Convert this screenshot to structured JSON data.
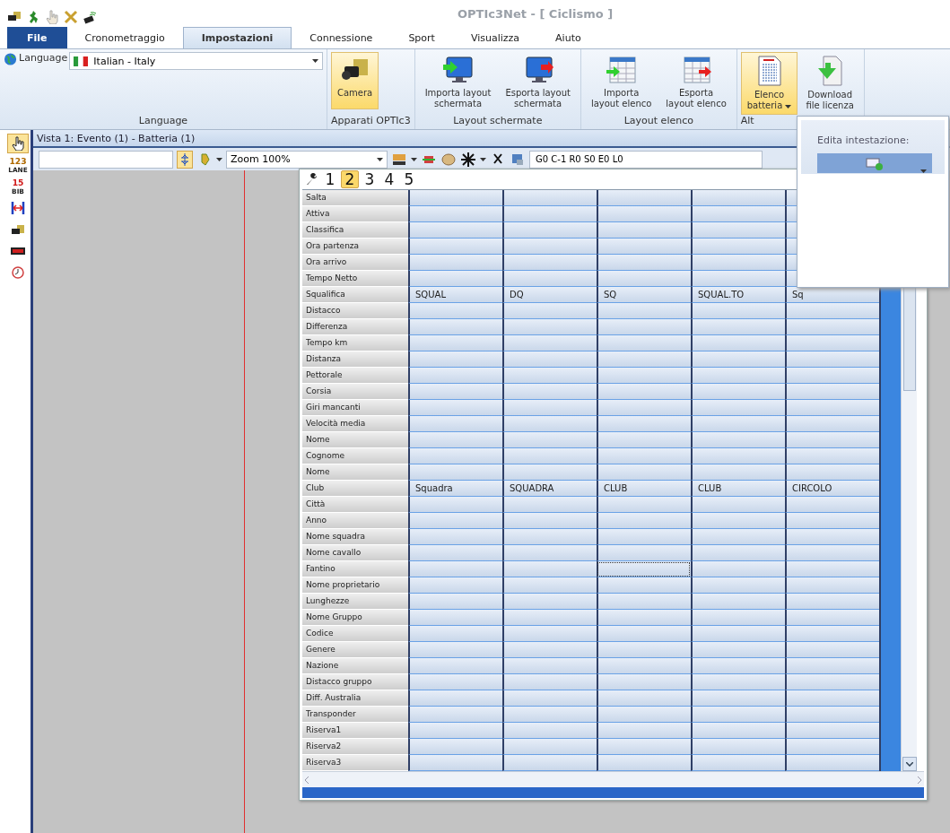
{
  "title_bar": {
    "title": "OPTIc3Net - [ Ciclismo ]"
  },
  "ribbon_tabs": [
    {
      "label": "File",
      "kind": "file",
      "selected": false
    },
    {
      "label": "Cronometraggio",
      "kind": "tab",
      "selected": false
    },
    {
      "label": "Impostazioni",
      "kind": "tab",
      "selected": true
    },
    {
      "label": "Connessione",
      "kind": "tab",
      "selected": false
    },
    {
      "label": "Sport",
      "kind": "tab",
      "selected": false
    },
    {
      "label": "Visualizza",
      "kind": "tab",
      "selected": false
    },
    {
      "label": "Aiuto",
      "kind": "tab",
      "selected": false
    }
  ],
  "ribbon_groups": [
    {
      "label": "Language",
      "kind": "language",
      "caption": "Language",
      "value": "Italian - Italy"
    },
    {
      "label": "Apparati OPTIc3",
      "kind": "buttons",
      "buttons": [
        {
          "label": "Camera",
          "kind": "camera",
          "selected": true,
          "dropdown": false
        }
      ]
    },
    {
      "label": "Layout schermate",
      "kind": "buttons",
      "buttons": [
        {
          "label": "Importa layout\nschermata",
          "kind": "monitor-in",
          "selected": false,
          "dropdown": false
        },
        {
          "label": "Esporta layout\nschermata",
          "kind": "monitor-out",
          "selected": false,
          "dropdown": false
        }
      ]
    },
    {
      "label": "Layout elenco",
      "kind": "buttons",
      "buttons": [
        {
          "label": "Importa\nlayout elenco",
          "kind": "table-in",
          "selected": false,
          "dropdown": false
        },
        {
          "label": "Esporta\nlayout elenco",
          "kind": "table-out",
          "selected": false,
          "dropdown": false
        }
      ]
    },
    {
      "label": "Alt",
      "kind": "buttons",
      "buttons": [
        {
          "label": "Elenco\nbatteria",
          "kind": "list",
          "selected": true,
          "dropdown": true
        },
        {
          "label": "Download\nfile licenza",
          "kind": "download",
          "selected": false,
          "dropdown": false
        }
      ]
    }
  ],
  "popup": {
    "title": "Edita intestazione:"
  },
  "tools": [
    {
      "kind": "hand",
      "selected": true
    },
    {
      "kind": "lane",
      "text": "123",
      "subtext": "LANE",
      "selected": false
    },
    {
      "kind": "bib",
      "text": "15",
      "subtext": "BIB",
      "selected": false
    },
    {
      "kind": "width",
      "selected": false
    },
    {
      "kind": "camera",
      "selected": false
    },
    {
      "kind": "display",
      "selected": false
    },
    {
      "kind": "clock",
      "selected": false
    }
  ],
  "view": {
    "title": "Vista 1: Evento (1) - Batteria (1)",
    "zoom": "Zoom 100%",
    "status_field": "G0 C-1 R0 S0 E0 L0"
  },
  "grid": {
    "number_tabs": [
      {
        "label": "1",
        "selected": false
      },
      {
        "label": "2",
        "selected": true
      },
      {
        "label": "3",
        "selected": false
      },
      {
        "label": "4",
        "selected": false
      },
      {
        "label": "5",
        "selected": false
      }
    ],
    "rows": [
      {
        "label": "Salta",
        "focused": false
      },
      {
        "label": "Attiva",
        "focused": false
      },
      {
        "label": "Classifica",
        "focused": false
      },
      {
        "label": "Ora partenza",
        "focused": false
      },
      {
        "label": "Ora arrivo",
        "focused": false
      },
      {
        "label": "Tempo Netto",
        "focused": false
      },
      {
        "label": "Squalifica",
        "focused": false,
        "values": [
          "SQUAL",
          "DQ",
          "SQ",
          "SQUAL.TO",
          "Sq"
        ]
      },
      {
        "label": "Distacco",
        "focused": false
      },
      {
        "label": "Differenza",
        "focused": false
      },
      {
        "label": "Tempo km",
        "focused": false
      },
      {
        "label": "Distanza",
        "focused": false
      },
      {
        "label": "Pettorale",
        "focused": false
      },
      {
        "label": "Corsia",
        "focused": false
      },
      {
        "label": "Giri mancanti",
        "focused": false
      },
      {
        "label": "Velocità media",
        "focused": false
      },
      {
        "label": "Nome",
        "focused": false
      },
      {
        "label": "Cognome",
        "focused": false
      },
      {
        "label": "Nome",
        "focused": false
      },
      {
        "label": "Club",
        "focused": false,
        "values": [
          "Squadra",
          "SQUADRA",
          "CLUB",
          "CLUB",
          "CIRCOLO"
        ]
      },
      {
        "label": "Città",
        "focused": false
      },
      {
        "label": "Anno",
        "focused": false
      },
      {
        "label": "Nome squadra",
        "focused": false
      },
      {
        "label": "Nome cavallo",
        "focused": false
      },
      {
        "label": "Fantino",
        "focused": true
      },
      {
        "label": "Nome proprietario",
        "focused": false
      },
      {
        "label": "Lunghezze",
        "focused": false
      },
      {
        "label": "Nome Gruppo",
        "focused": false
      },
      {
        "label": "Codice",
        "focused": false
      },
      {
        "label": "Genere",
        "focused": false
      },
      {
        "label": "Nazione",
        "focused": false
      },
      {
        "label": "Distacco gruppo",
        "focused": false
      },
      {
        "label": "Diff. Australia",
        "focused": false
      },
      {
        "label": "Transponder",
        "focused": false
      },
      {
        "label": "Riserva1",
        "focused": false
      },
      {
        "label": "Riserva2",
        "focused": false
      },
      {
        "label": "Riserva3",
        "focused": false
      }
    ]
  }
}
